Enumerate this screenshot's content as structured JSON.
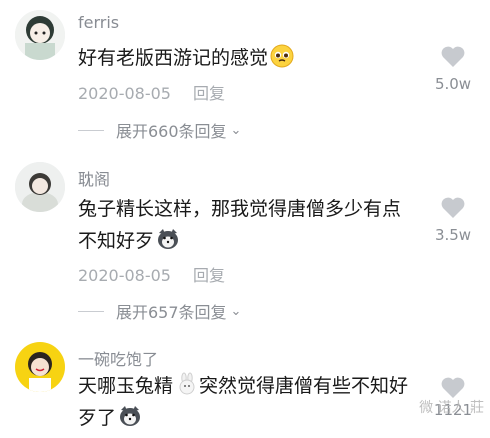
{
  "comments": [
    {
      "username": "ferris",
      "text": "好有老版西游记的感觉",
      "emoji": "pleading-face-emoji",
      "date": "2020-08-05",
      "reply_label": "回复",
      "likes": "5.0w",
      "expand_label": "展开660条回复"
    },
    {
      "username": "耽阁",
      "text": "兔子精长这样，那我觉得唐僧多少有点不知好歹",
      "emoji": "husky-emoji",
      "date": "2020-08-05",
      "reply_label": "回复",
      "likes": "3.5w",
      "expand_label": "展开657条回复"
    },
    {
      "username": "一碗吃饱了",
      "text_part1": "天哪玉兔精",
      "text_part2": "突然觉得唐僧有些不知好歹了",
      "emojis": [
        "rabbit-emoji",
        "husky-emoji"
      ],
      "likes": "1121"
    }
  ],
  "watermark": "微 诺人 莊",
  "colors": {
    "username": "#888c93",
    "text": "#1a1a1a",
    "meta": "#a7abb0",
    "heart": "#c7cacf"
  }
}
